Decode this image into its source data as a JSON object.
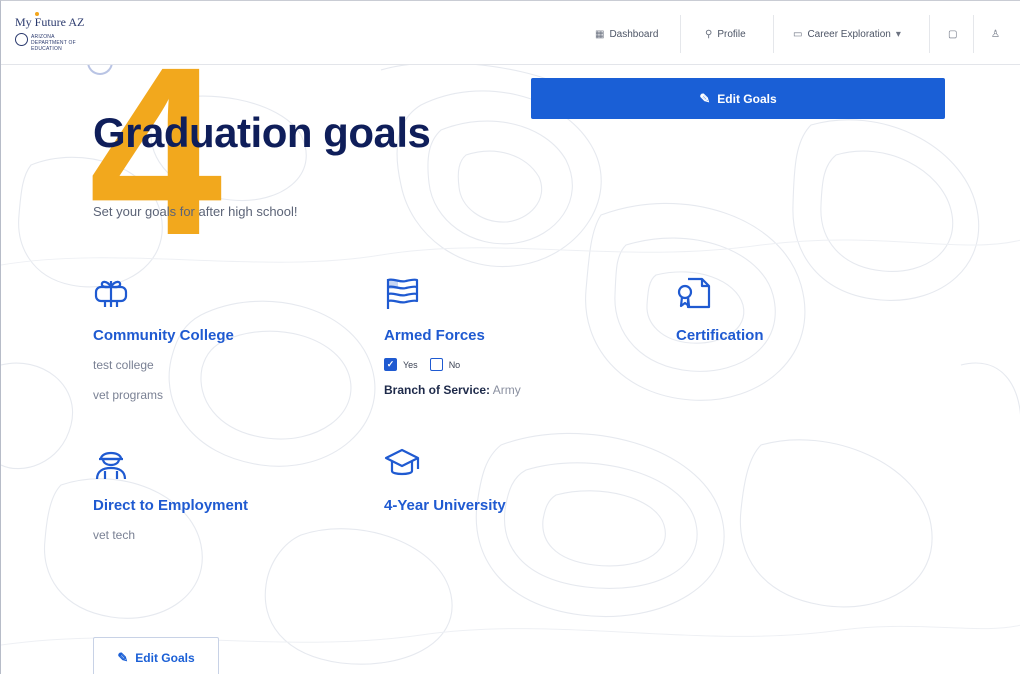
{
  "header": {
    "logo_title": "My Future AZ",
    "logo_subtitle": "ARIZONA DEPARTMENT OF EDUCATION",
    "nav": {
      "dashboard": "Dashboard",
      "profile": "Profile",
      "career_exploration": "Career Exploration"
    }
  },
  "section": {
    "step_number": "4",
    "title": "Graduation goals",
    "subtitle": "Set your goals for after high school!",
    "edit_label_top": "Edit Goals",
    "edit_label_bottom": "Edit Goals"
  },
  "goals": {
    "community_college": {
      "title": "Community College",
      "lines": [
        "test college",
        "vet programs"
      ]
    },
    "armed_forces": {
      "title": "Armed Forces",
      "yes_label": "Yes",
      "no_label": "No",
      "yes_checked": true,
      "no_checked": false,
      "branch_label": "Branch of Service:",
      "branch_value": "Army"
    },
    "certification": {
      "title": "Certification"
    },
    "direct_to_employment": {
      "title": "Direct to Employment",
      "lines": [
        "vet tech"
      ]
    },
    "four_year_university": {
      "title": "4-Year University"
    }
  },
  "colors": {
    "primary_blue": "#1a5fd6",
    "number_orange": "#f2a81d",
    "title_navy": "#0f1e5a"
  },
  "icons": {
    "dashboard": "dashboard-icon",
    "profile": "profile-icon",
    "career": "document-icon",
    "notifications": "notification-icon",
    "user": "user-avatar-icon",
    "edit": "edit-icon",
    "community_college": "gift-scroll-icon",
    "armed_forces": "flag-icon",
    "certification": "certificate-icon",
    "employment": "worker-icon",
    "university": "graduation-cap-icon"
  }
}
